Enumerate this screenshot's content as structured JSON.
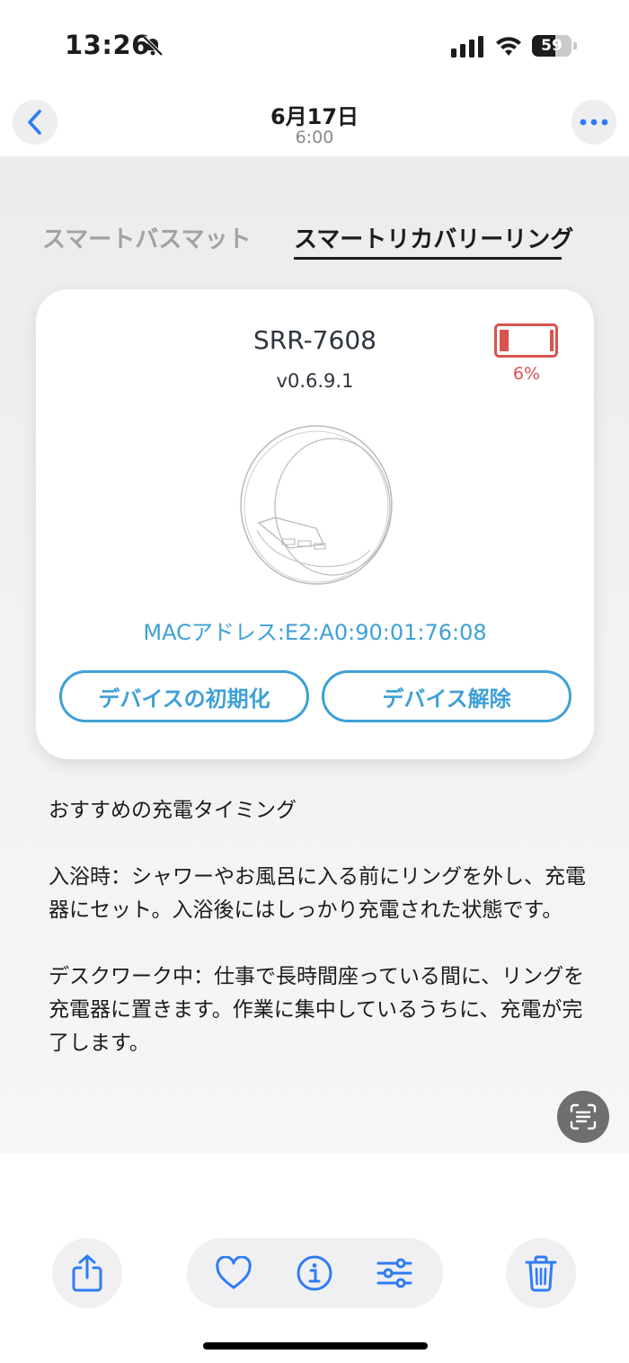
{
  "status_bar": {
    "time": "13:26",
    "battery": "59"
  },
  "photo_header": {
    "date": "6月17日",
    "time": "6:00"
  },
  "tabs": [
    {
      "label": "スマートバスマット",
      "active": false
    },
    {
      "label": "スマートリカバリーリング",
      "active": true
    }
  ],
  "device": {
    "model": "SRR-7608",
    "version": "v0.6.9.1",
    "battery_percent": "6%",
    "battery_level": 0.06,
    "mac": "MACアドレス:E2:A0:90:01:76:08",
    "init_button": "デバイスの初期化",
    "unpair_button": "デバイス解除"
  },
  "tips": {
    "heading": "おすすめの充電タイミング",
    "bath": "入浴時：シャワーやお風呂に入る前にリングを外し、充電器にセット。入浴後にはしっかり充電された状態です。",
    "desk": "デスクワーク中：仕事で長時間座っている間に、リングを充電器に置きます。作業に集中しているうちに、充電が完了します。"
  },
  "colors": {
    "accent": "#3fa0d6",
    "battery_low": "#d9534f",
    "ios_blue": "#2f7cf6"
  },
  "icons": [
    "bell-slash-icon",
    "cellular-signal-icon",
    "wifi-icon",
    "back-chevron-icon",
    "more-icon",
    "battery-low-icon",
    "ring-product-icon",
    "live-text-icon",
    "share-icon",
    "heart-icon",
    "info-icon",
    "adjust-icon",
    "trash-icon"
  ]
}
